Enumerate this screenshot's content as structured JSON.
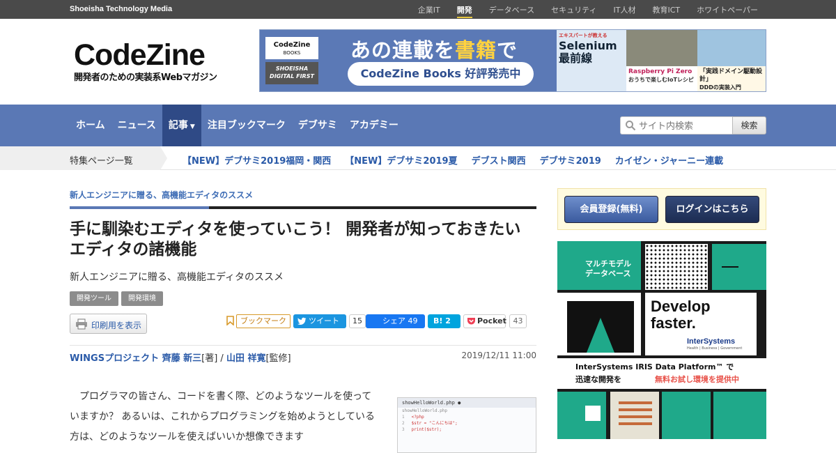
{
  "topbar": {
    "brand": "Shoeisha Technology Media",
    "nav": [
      "企業IT",
      "開発",
      "データベース",
      "セキュリティ",
      "IT人材",
      "教育ICT",
      "ホワイトペーパー"
    ],
    "active": "開発"
  },
  "logo": {
    "word": "CodeZine",
    "tagline": "開発者のための実装系Webマガジン"
  },
  "banner": {
    "books_label_1": "CodeZine",
    "books_label_2": "BOOKS",
    "books_label_3": "SHOEISHA",
    "books_label_4": "DIGITAL FIRST",
    "headline_pre": "あの連載を",
    "headline_hl": "書籍",
    "headline_post": "で",
    "pill": "CodeZine Books 好評発売中",
    "cover1_small": "エキスパートが教える",
    "cover1_big": "Selenium 最前線",
    "cover3": "Raspberry Pi Zero",
    "cover3_sub": "おうちで楽しむIoTレシピ",
    "cover5": "「実践ドメイン駆動設計」",
    "cover5_sub": "DDDの実装入門"
  },
  "mainnav": {
    "items": [
      "ホーム",
      "ニュース",
      "記事",
      "注目ブックマーク",
      "デブサミ",
      "アカデミー"
    ],
    "active_index": 2
  },
  "search": {
    "placeholder": "サイト内検索",
    "button": "検索"
  },
  "featbar": {
    "label": "特集ページ一覧",
    "links": [
      "【NEW】デブサミ2019福岡・関西",
      "【NEW】デブサミ2019夏",
      "デブスト関西",
      "デブサミ2019",
      "カイゼン・ジャーニー連載"
    ]
  },
  "article": {
    "kicker": "新人エンジニアに贈る、高機能エディタのススメ",
    "title": "手に馴染むエディタを使っていこう！ 開発者が知っておきたいエディタの諸機能",
    "subtitle": "新人エンジニアに贈る、高機能エディタのススメ",
    "tags": [
      "開発ツール",
      "開発環境"
    ],
    "print": "印刷用を表示",
    "share": {
      "bookmark": "ブックマーク",
      "tweet": "ツイート",
      "tweet_count": "15",
      "facebook": "シェア 49",
      "hatena": "B! 2",
      "pocket": "Pocket",
      "pocket_count": "43"
    },
    "author1": "WINGSプロジェクト 齊藤 新三",
    "author1_role": "[著] / ",
    "author2": "山田 祥寛",
    "author2_role": "[監修]",
    "date": "2019/12/11 11:00",
    "body": "プログラマの皆さん、コードを書く際、どのようなツールを使っていますか？ あるいは、これからプログラミングを始めようとしている方は、どのようなツールを使えばいいか想像できます",
    "code_tab": "showHelloWorld.php",
    "code_file": "showHelloWorld.php",
    "code_lines": [
      "<?php",
      "$str = \"こんにちは\";",
      "print($str);"
    ]
  },
  "sidebar": {
    "register": "会員登録(無料)",
    "login": "ログインはこちら",
    "ad": {
      "label1": "マルチモデル",
      "label2": "データベース",
      "develop": "Develop",
      "faster": "faster.",
      "brand": "InterSystems",
      "brand_sub": "Health | Business | Government",
      "line1": "InterSystems IRIS Data Platform™ で",
      "line2": "迅速な開発を",
      "cta": "無料お試し環境を提供中"
    }
  },
  "colors": {
    "nav": "#5a78b5",
    "nav_active": "#2f4a86",
    "link": "#2a5aa8",
    "topbar": "#4a4a4a"
  }
}
